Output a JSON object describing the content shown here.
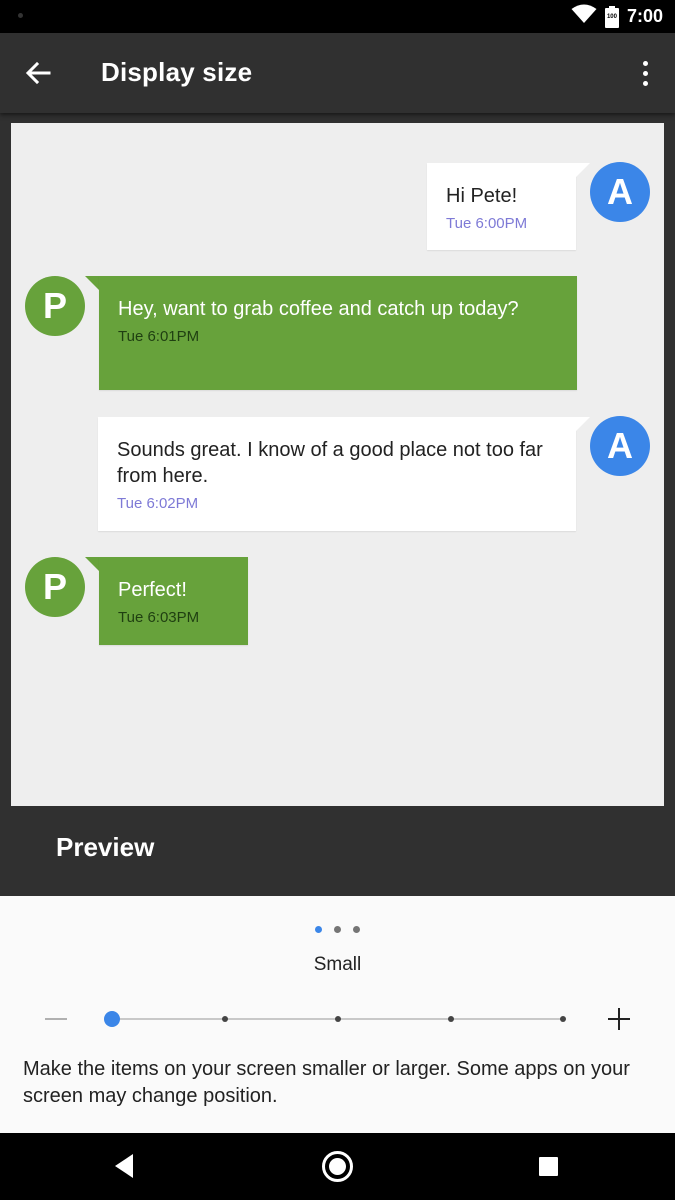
{
  "status_bar": {
    "time": "7:00",
    "battery_label": "100",
    "icons": [
      "wifi-icon",
      "battery-icon"
    ]
  },
  "app_bar": {
    "title": "Display size",
    "back_icon": "arrow-back-icon",
    "menu_icon": "more-vert-icon"
  },
  "preview": {
    "messages": [
      {
        "sender": "A",
        "side": "right",
        "text": "Hi Pete!",
        "time": "Tue 6:00PM"
      },
      {
        "sender": "P",
        "side": "left",
        "text": "Hey, want to grab coffee and catch up today?",
        "time": "Tue 6:01PM"
      },
      {
        "sender": "A",
        "side": "right",
        "text": "Sounds great. I know of a good place not too far from here.",
        "time": "Tue 6:02PM"
      },
      {
        "sender": "P",
        "side": "left",
        "text": "Perfect!",
        "time": "Tue 6:03PM"
      }
    ],
    "label": "Preview"
  },
  "size_control": {
    "page_count": 3,
    "active_page": 0,
    "size_label": "Small",
    "minus_icon": "minus-icon",
    "plus_icon": "plus-icon",
    "slider_steps": 5,
    "slider_position": 0,
    "help_text": "Make the items on your screen smaller or larger. Some apps on your screen may change position."
  },
  "nav_bar": {
    "icons": [
      "nav-back-icon",
      "nav-home-icon",
      "nav-recents-icon"
    ]
  },
  "colors": {
    "accent_blue": "#3b86e8",
    "bubble_green": "#67a23b",
    "timestamp_purple": "#7e7ad6",
    "app_bar": "#303030"
  }
}
